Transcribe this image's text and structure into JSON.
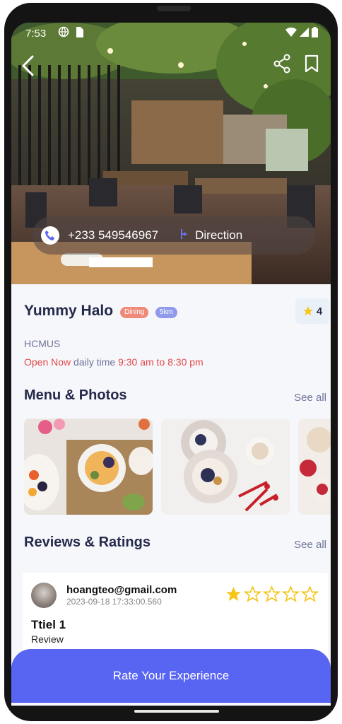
{
  "status": {
    "time": "7:53"
  },
  "contact": {
    "phone": "+233 549546967",
    "direction_label": "Direction"
  },
  "venue": {
    "name": "Yummy Halo",
    "tags": [
      "Dining",
      "5km"
    ],
    "rating": "4",
    "subtitle": "HCMUS",
    "open_status": "Open Now",
    "daily_label": "daily time",
    "hours": "9:30 am to 8:30 pm"
  },
  "menu": {
    "title": "Menu & Photos",
    "see_all": "See all"
  },
  "reviews": {
    "title": "Reviews & Ratings",
    "see_all": "See all",
    "items": [
      {
        "user": "hoangteo@gmail.com",
        "date": "2023-09-18 17:33:00.560",
        "stars": 1,
        "title": "Ttiel 1",
        "body": "Review"
      }
    ]
  },
  "cta": {
    "label": "Rate Your Experience"
  },
  "colors": {
    "accent": "#5864f2",
    "star": "#f5c518",
    "open": "#e24a4a"
  }
}
